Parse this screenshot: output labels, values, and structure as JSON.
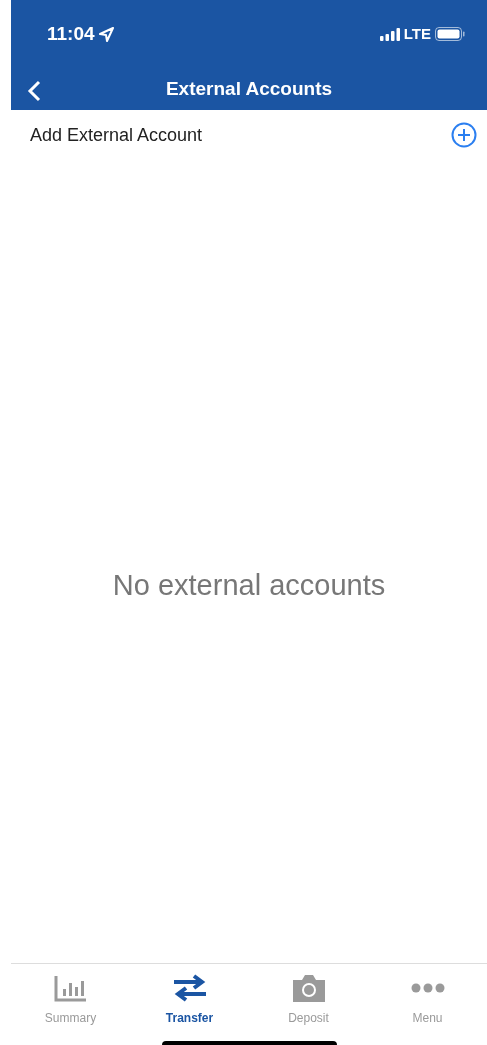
{
  "status_bar": {
    "time": "11:04",
    "network": "LTE"
  },
  "nav": {
    "title": "External Accounts"
  },
  "add_row": {
    "label": "Add External Account"
  },
  "empty_message": "No external accounts",
  "tab_bar": [
    {
      "kind": "chart",
      "label": "Summary",
      "selected": false
    },
    {
      "kind": "transfer",
      "label": "Transfer",
      "selected": true
    },
    {
      "kind": "camera",
      "label": "Deposit",
      "selected": false
    },
    {
      "kind": "dots",
      "label": "Menu",
      "selected": false
    }
  ]
}
